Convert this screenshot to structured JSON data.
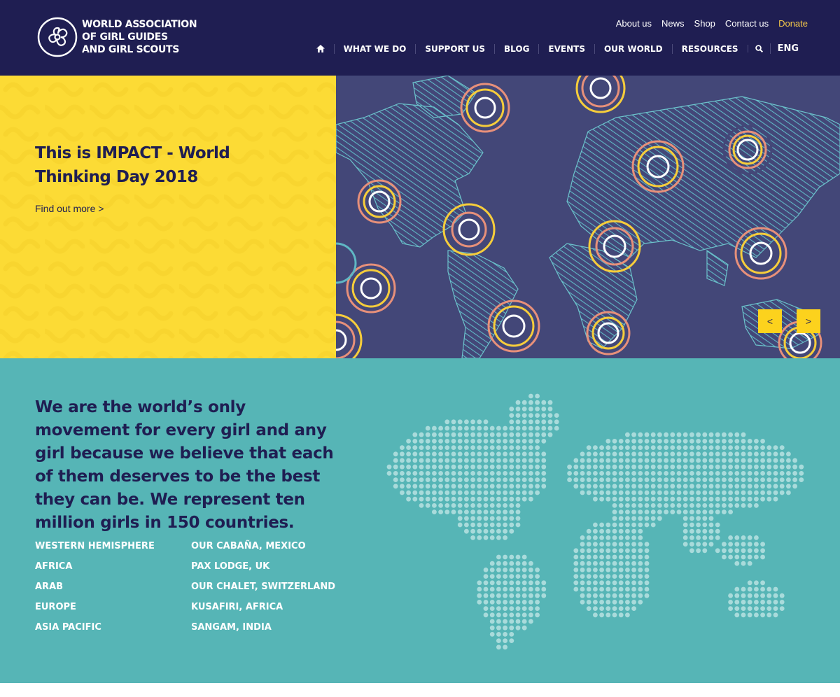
{
  "brand": {
    "line1": "WORLD ASSOCIATION",
    "line2": "OF GIRL GUIDES",
    "line3": "AND GIRL SCOUTS"
  },
  "utility_nav": [
    "About us",
    "News",
    "Shop",
    "Contact us",
    "Donate"
  ],
  "main_nav": [
    "WHAT WE DO",
    "SUPPORT US",
    "BLOG",
    "EVENTS",
    "OUR WORLD",
    "RESOURCES"
  ],
  "language": "ENG",
  "icons": {
    "home": "home-icon",
    "search": "search-icon",
    "logo": "trefoil-logo-icon"
  },
  "hero": {
    "title": "This is IMPACT - World Thinking Day 2018",
    "link": "Find out more >",
    "prev": "<",
    "next": ">"
  },
  "about": {
    "text": "We are the world’s only movement for every girl and any girl because we believe that each of them deserves to be the best they can be. We represent ten million girls in 150 countries."
  },
  "regions": [
    "WESTERN HEMISPHERE",
    "AFRICA",
    "ARAB",
    "EUROPE",
    "ASIA PACIFIC"
  ],
  "centres": [
    "OUR CABAÑA, MEXICO",
    "PAX LODGE, UK",
    "OUR CHALET, SWITZERLAND",
    "KUSAFIRI, AFRICA",
    "SANGAM, INDIA"
  ],
  "colors": {
    "navy": "#1f1e52",
    "yellow": "#fcdb35",
    "teal": "#56b5b6",
    "map_bg": "#434778",
    "donate": "#f6c94a"
  }
}
